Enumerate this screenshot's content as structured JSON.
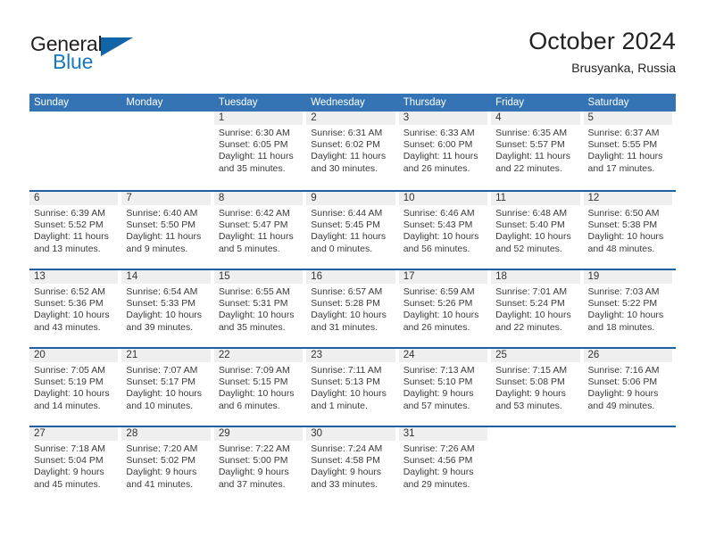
{
  "brand": {
    "name_part1": "General",
    "name_part2": "Blue",
    "color_primary": "#1164a8",
    "color_text": "#231f20"
  },
  "header": {
    "title": "October 2024",
    "subtitle": "Brusyanka, Russia"
  },
  "theme": {
    "header_blue": "#3474b4",
    "rule_blue": "#1c5fa5",
    "daynum_band": "#efefef"
  },
  "weekdays": [
    "Sunday",
    "Monday",
    "Tuesday",
    "Wednesday",
    "Thursday",
    "Friday",
    "Saturday"
  ],
  "weeks": [
    [
      {
        "day": "",
        "lines": []
      },
      {
        "day": "",
        "lines": []
      },
      {
        "day": "1",
        "lines": [
          "Sunrise: 6:30 AM",
          "Sunset: 6:05 PM",
          "Daylight: 11 hours",
          "and 35 minutes."
        ]
      },
      {
        "day": "2",
        "lines": [
          "Sunrise: 6:31 AM",
          "Sunset: 6:02 PM",
          "Daylight: 11 hours",
          "and 30 minutes."
        ]
      },
      {
        "day": "3",
        "lines": [
          "Sunrise: 6:33 AM",
          "Sunset: 6:00 PM",
          "Daylight: 11 hours",
          "and 26 minutes."
        ]
      },
      {
        "day": "4",
        "lines": [
          "Sunrise: 6:35 AM",
          "Sunset: 5:57 PM",
          "Daylight: 11 hours",
          "and 22 minutes."
        ]
      },
      {
        "day": "5",
        "lines": [
          "Sunrise: 6:37 AM",
          "Sunset: 5:55 PM",
          "Daylight: 11 hours",
          "and 17 minutes."
        ]
      }
    ],
    [
      {
        "day": "6",
        "lines": [
          "Sunrise: 6:39 AM",
          "Sunset: 5:52 PM",
          "Daylight: 11 hours",
          "and 13 minutes."
        ]
      },
      {
        "day": "7",
        "lines": [
          "Sunrise: 6:40 AM",
          "Sunset: 5:50 PM",
          "Daylight: 11 hours",
          "and 9 minutes."
        ]
      },
      {
        "day": "8",
        "lines": [
          "Sunrise: 6:42 AM",
          "Sunset: 5:47 PM",
          "Daylight: 11 hours",
          "and 5 minutes."
        ]
      },
      {
        "day": "9",
        "lines": [
          "Sunrise: 6:44 AM",
          "Sunset: 5:45 PM",
          "Daylight: 11 hours",
          "and 0 minutes."
        ]
      },
      {
        "day": "10",
        "lines": [
          "Sunrise: 6:46 AM",
          "Sunset: 5:43 PM",
          "Daylight: 10 hours",
          "and 56 minutes."
        ]
      },
      {
        "day": "11",
        "lines": [
          "Sunrise: 6:48 AM",
          "Sunset: 5:40 PM",
          "Daylight: 10 hours",
          "and 52 minutes."
        ]
      },
      {
        "day": "12",
        "lines": [
          "Sunrise: 6:50 AM",
          "Sunset: 5:38 PM",
          "Daylight: 10 hours",
          "and 48 minutes."
        ]
      }
    ],
    [
      {
        "day": "13",
        "lines": [
          "Sunrise: 6:52 AM",
          "Sunset: 5:36 PM",
          "Daylight: 10 hours",
          "and 43 minutes."
        ]
      },
      {
        "day": "14",
        "lines": [
          "Sunrise: 6:54 AM",
          "Sunset: 5:33 PM",
          "Daylight: 10 hours",
          "and 39 minutes."
        ]
      },
      {
        "day": "15",
        "lines": [
          "Sunrise: 6:55 AM",
          "Sunset: 5:31 PM",
          "Daylight: 10 hours",
          "and 35 minutes."
        ]
      },
      {
        "day": "16",
        "lines": [
          "Sunrise: 6:57 AM",
          "Sunset: 5:28 PM",
          "Daylight: 10 hours",
          "and 31 minutes."
        ]
      },
      {
        "day": "17",
        "lines": [
          "Sunrise: 6:59 AM",
          "Sunset: 5:26 PM",
          "Daylight: 10 hours",
          "and 26 minutes."
        ]
      },
      {
        "day": "18",
        "lines": [
          "Sunrise: 7:01 AM",
          "Sunset: 5:24 PM",
          "Daylight: 10 hours",
          "and 22 minutes."
        ]
      },
      {
        "day": "19",
        "lines": [
          "Sunrise: 7:03 AM",
          "Sunset: 5:22 PM",
          "Daylight: 10 hours",
          "and 18 minutes."
        ]
      }
    ],
    [
      {
        "day": "20",
        "lines": [
          "Sunrise: 7:05 AM",
          "Sunset: 5:19 PM",
          "Daylight: 10 hours",
          "and 14 minutes."
        ]
      },
      {
        "day": "21",
        "lines": [
          "Sunrise: 7:07 AM",
          "Sunset: 5:17 PM",
          "Daylight: 10 hours",
          "and 10 minutes."
        ]
      },
      {
        "day": "22",
        "lines": [
          "Sunrise: 7:09 AM",
          "Sunset: 5:15 PM",
          "Daylight: 10 hours",
          "and 6 minutes."
        ]
      },
      {
        "day": "23",
        "lines": [
          "Sunrise: 7:11 AM",
          "Sunset: 5:13 PM",
          "Daylight: 10 hours",
          "and 1 minute."
        ]
      },
      {
        "day": "24",
        "lines": [
          "Sunrise: 7:13 AM",
          "Sunset: 5:10 PM",
          "Daylight: 9 hours",
          "and 57 minutes."
        ]
      },
      {
        "day": "25",
        "lines": [
          "Sunrise: 7:15 AM",
          "Sunset: 5:08 PM",
          "Daylight: 9 hours",
          "and 53 minutes."
        ]
      },
      {
        "day": "26",
        "lines": [
          "Sunrise: 7:16 AM",
          "Sunset: 5:06 PM",
          "Daylight: 9 hours",
          "and 49 minutes."
        ]
      }
    ],
    [
      {
        "day": "27",
        "lines": [
          "Sunrise: 7:18 AM",
          "Sunset: 5:04 PM",
          "Daylight: 9 hours",
          "and 45 minutes."
        ]
      },
      {
        "day": "28",
        "lines": [
          "Sunrise: 7:20 AM",
          "Sunset: 5:02 PM",
          "Daylight: 9 hours",
          "and 41 minutes."
        ]
      },
      {
        "day": "29",
        "lines": [
          "Sunrise: 7:22 AM",
          "Sunset: 5:00 PM",
          "Daylight: 9 hours",
          "and 37 minutes."
        ]
      },
      {
        "day": "30",
        "lines": [
          "Sunrise: 7:24 AM",
          "Sunset: 4:58 PM",
          "Daylight: 9 hours",
          "and 33 minutes."
        ]
      },
      {
        "day": "31",
        "lines": [
          "Sunrise: 7:26 AM",
          "Sunset: 4:56 PM",
          "Daylight: 9 hours",
          "and 29 minutes."
        ]
      },
      {
        "day": "",
        "lines": []
      },
      {
        "day": "",
        "lines": []
      }
    ]
  ]
}
